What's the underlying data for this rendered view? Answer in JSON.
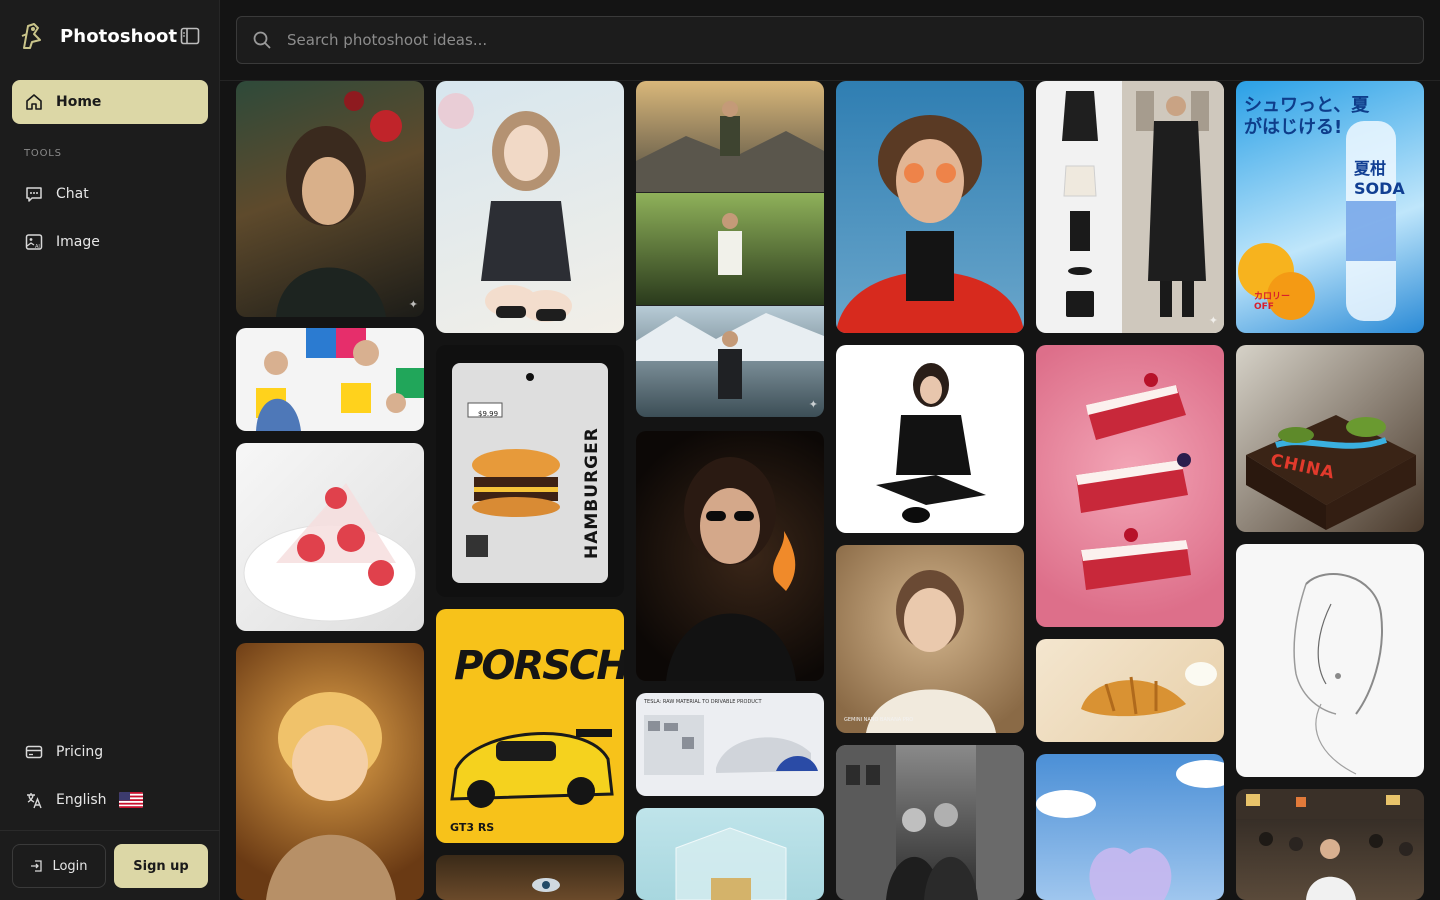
{
  "brand": {
    "name": "Photoshoot"
  },
  "nav": {
    "home": "Home",
    "section_tools": "TOOLS",
    "chat": "Chat",
    "image": "Image",
    "pricing": "Pricing",
    "language": "English"
  },
  "auth": {
    "login": "Login",
    "signup": "Sign up"
  },
  "search": {
    "placeholder": "Search photoshoot ideas..."
  },
  "card_text": {
    "hamburger": "HAMBURGER",
    "price": "$9.99",
    "porsche": "PORSCHE",
    "gt3rs": "GT3 RS",
    "china": "CHINA",
    "soda_jp": "シュワっと、夏がはじける!",
    "soda_brand": "夏柑 SODA",
    "calorie_off": "カロリー OFF",
    "gemini": "GEMINI NANO BANANA PRO",
    "tesla": "TESLA: RAW MATERIAL TO DRIVABLE PRODUCT"
  },
  "colors": {
    "accent": "#dcd7a6",
    "sidebar": "#1c1c1c",
    "background": "#141414"
  }
}
